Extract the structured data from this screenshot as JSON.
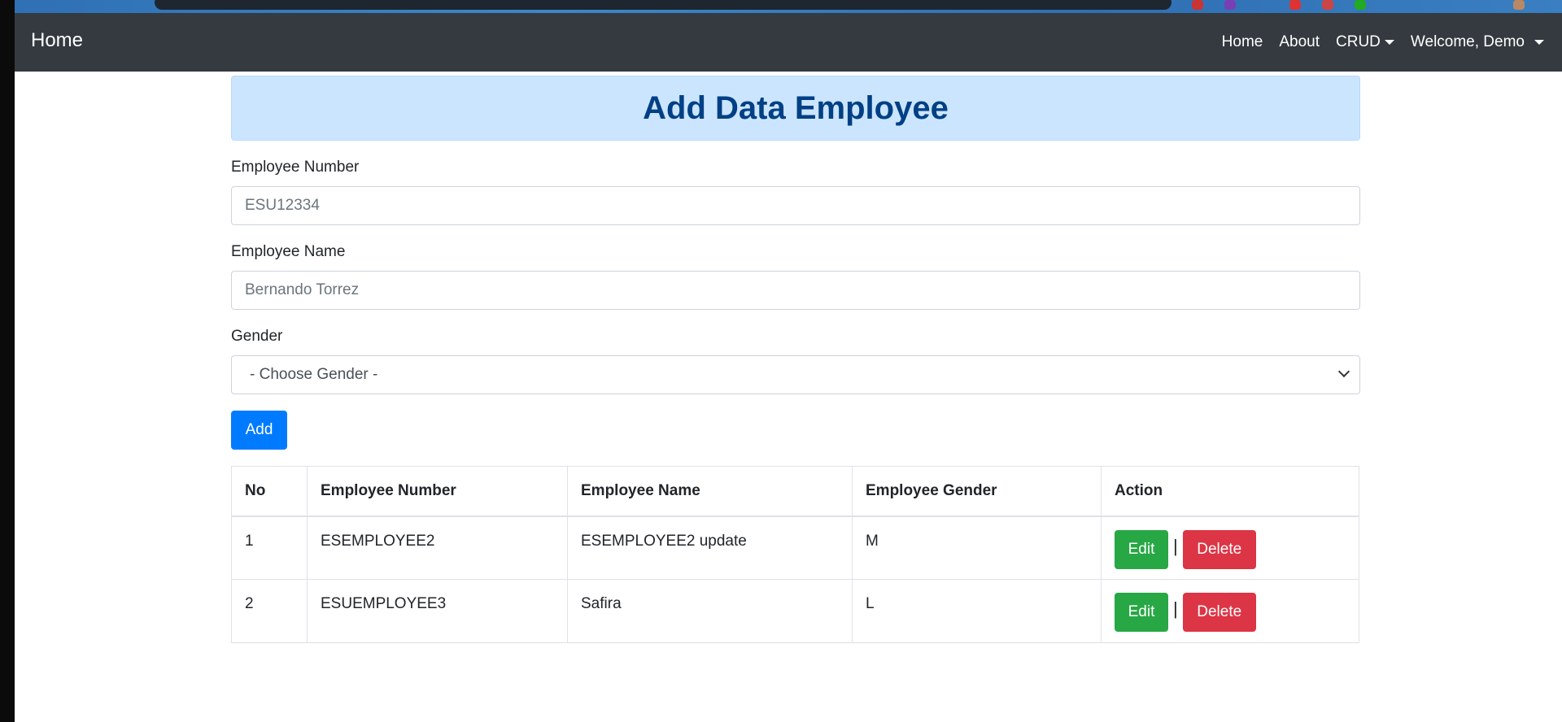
{
  "navbar": {
    "brand": "Home",
    "links": [
      "Home",
      "About",
      "CRUD",
      "Welcome, Demo"
    ]
  },
  "header": {
    "title": "Add Data Employee"
  },
  "form": {
    "employee_number_label": "Employee Number",
    "employee_number_placeholder": "ESU12334",
    "employee_name_label": "Employee Name",
    "employee_name_placeholder": "Bernando Torrez",
    "gender_label": "Gender",
    "gender_selected": "- Choose Gender -",
    "add_label": "Add"
  },
  "table": {
    "headers": [
      "No",
      "Employee Number",
      "Employee Name",
      "Employee Gender",
      "Action"
    ],
    "rows": [
      {
        "no": "1",
        "number": "ESEMPLOYEE2",
        "name": "ESEMPLOYEE2 update",
        "gender": "M",
        "edit": "Edit",
        "sep": "|",
        "delete": "Delete"
      },
      {
        "no": "2",
        "number": "ESUEMPLOYEE3",
        "name": "Safira",
        "gender": "L",
        "edit": "Edit",
        "sep": "|",
        "delete": "Delete"
      }
    ]
  },
  "colors": {
    "navbar_bg": "#343a40",
    "alert_bg": "#cce5ff",
    "alert_text": "#004085",
    "primary": "#007bff",
    "success": "#28a745",
    "danger": "#dc3545"
  }
}
